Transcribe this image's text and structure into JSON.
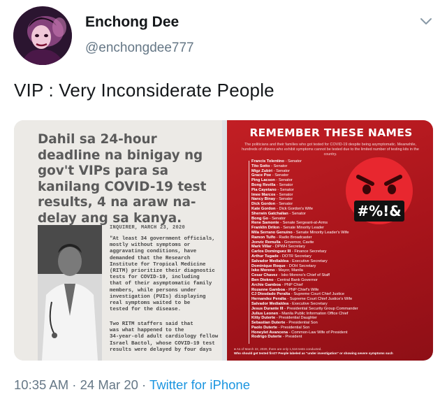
{
  "author": {
    "display_name": "Enchong Dee",
    "handle": "@enchongdee777"
  },
  "tweet": {
    "text": "VIP : Very Inconsiderate People"
  },
  "media_left": {
    "headline": "Dahil sa 24-hour deadline na binigay ng gov't VIPs para sa kanilang COVID-19 test results, 4 na araw na-delay ang sa kanya.",
    "dateline": "INQUIRER, MARCH 23, 2020",
    "body": "\"At least 34 government officials,\nmostly without symptoms or\naggravating conditions, have\ndemanded that the Research\nInstitute for Tropical Medicine\n(RITM) prioritize their diagnostic\ntests for COVID-19, including\nthat of their asymptomatic family\nmembers, while persons under\ninvestigation (PUIs) displaying\nreal symptoms waited to be\ntested for the disease.",
    "body2": "Two RITM staffers said that\nwas what happened to the\n34-year-old adult cardiology fellow\nIsrael Bactol, whose COVID-19 test\nresults were delayed by four days"
  },
  "media_right": {
    "title": "REMEMBER THESE NAMES",
    "subtitle": "The politicians and their families who got tested for COVID-19 despite being asymptomatic. Meanwhile, hundreds of citizens who exhibit symptoms cannot be tested due to the limited number of testing kits in the country.",
    "emoji_text": "#%!&",
    "names": [
      {
        "name": "Francis Tolentino",
        "role": " - Senator"
      },
      {
        "name": "Tito Sotto",
        "role": " - Senator"
      },
      {
        "name": "Migz Zubiri",
        "role": " - Senator"
      },
      {
        "name": "Grace Poe",
        "role": " - Senator"
      },
      {
        "name": "Ping Lacson",
        "role": " - Senator"
      },
      {
        "name": "Bong Revilla",
        "role": " - Senator"
      },
      {
        "name": "Pia Cayetano",
        "role": " - Senator"
      },
      {
        "name": "Imee Marcos",
        "role": " - Senator"
      },
      {
        "name": "Nancy Binay",
        "role": " - Senator"
      },
      {
        "name": "Dick Gordon",
        "role": " - Senator"
      },
      {
        "name": "Kate Gordon",
        "role": " - Dick Gordon's Wife"
      },
      {
        "name": "Sherwin Gatchalian",
        "role": " - Senator"
      },
      {
        "name": "Bong Go",
        "role": " - Senator"
      },
      {
        "name": "Rene Samonte",
        "role": " - Senate Sergeant-at-Arms"
      },
      {
        "name": "Franklin Drilon",
        "role": " - Senate Minority Leader"
      },
      {
        "name": "Mila Serrano Genuino",
        "role": " - Senate Minority Leader's Wife"
      },
      {
        "name": "Ramon Tulfo",
        "role": " - Radio Broadcaster"
      },
      {
        "name": "Jonvic Remulla",
        "role": " - Governor, Cavite"
      },
      {
        "name": "Mark Villar",
        "role": " - DPWH Secretary"
      },
      {
        "name": "Carlos Dominguez III",
        "role": " - Finance Secretary"
      },
      {
        "name": "Arthur Tugade",
        "role": " - DOTR Secretary"
      },
      {
        "name": "Salvador Medialdea",
        "role": " - Executive Secretary"
      },
      {
        "name": "Dominique Roque",
        "role": " - DOH Secretary"
      },
      {
        "name": "Isko Moreno",
        "role": " - Mayor, Manila"
      },
      {
        "name": "Cesar Chavez",
        "role": " - Isko Moreno's Chief of Staff"
      },
      {
        "name": "Ben Diokno",
        "role": " - Central Bank Governor"
      },
      {
        "name": "Archie Gamboa",
        "role": " - PNP Chief"
      },
      {
        "name": "Rozanne Gamboa",
        "role": " - PNP Chief's Wife"
      },
      {
        "name": "CJ Diosdado Peralta",
        "role": " - Supreme Court Chief Justice"
      },
      {
        "name": "Hernandez Peralta",
        "role": " - Supreme Court Chief Justice's Wife"
      },
      {
        "name": "Salvador Medialdea",
        "role": " - Executive Secretary"
      },
      {
        "name": "Jesus Durante III",
        "role": " - Presidential Security Group Commander"
      },
      {
        "name": "Julius Leonen",
        "role": " - Manila Public Information Office Chief"
      },
      {
        "name": "Kitty Duterte",
        "role": " - Presidential Daughter"
      },
      {
        "name": "Sebastian Duterte",
        "role": " - Presidential Son"
      },
      {
        "name": "Paolo Duterte",
        "role": " - Presidential Son"
      },
      {
        "name": "Honeylet Avancena",
        "role": " - Common-Law Wife of President"
      },
      {
        "name": "Rodrigo Duterte",
        "role": " - President"
      }
    ],
    "footnote": "● As of March 22, 2020, there are only 1,516 tests conducted.",
    "question": "Who should get tested first? People labeled as \"under investigation\" or showing severe symptoms such"
  },
  "meta": {
    "time": "10:35 AM",
    "separator1": " · ",
    "date": "24 Mar 20",
    "separator2": " · ",
    "source": "Twitter for iPhone"
  },
  "icons": {
    "chevron": "chevron-down-icon",
    "emoji": "angry-face-emoji"
  },
  "colors": {
    "handle_gray": "#657786",
    "link_blue": "#1b95e0",
    "poster_red": "#b5181e",
    "emoji_red": "#e8272f"
  }
}
